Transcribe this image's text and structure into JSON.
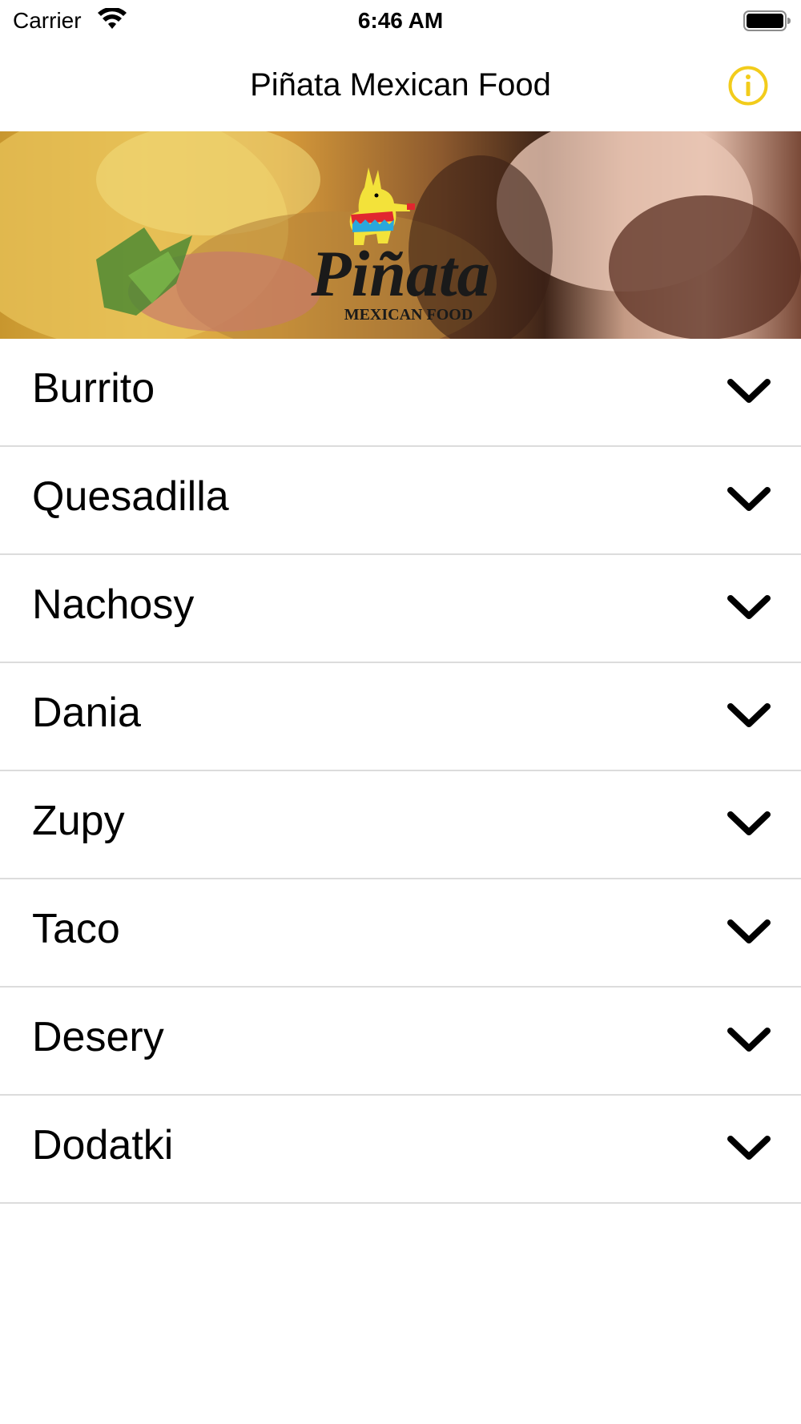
{
  "status_bar": {
    "carrier": "Carrier",
    "time": "6:46 AM",
    "wifi_icon": "wifi-icon",
    "battery_icon": "battery-full-icon"
  },
  "nav": {
    "title": "Piñata Mexican Food",
    "info_icon": "info-circle-icon",
    "accent_color": "#F2CC1B"
  },
  "hero": {
    "logo_text": "Piñata",
    "logo_subtext": "MEXICAN FOOD"
  },
  "menu": {
    "items": [
      {
        "label": "Burrito"
      },
      {
        "label": "Quesadilla"
      },
      {
        "label": "Nachosy"
      },
      {
        "label": "Dania"
      },
      {
        "label": "Zupy"
      },
      {
        "label": "Taco"
      },
      {
        "label": "Desery"
      },
      {
        "label": "Dodatki"
      }
    ],
    "chevron_icon": "chevron-down-icon"
  }
}
